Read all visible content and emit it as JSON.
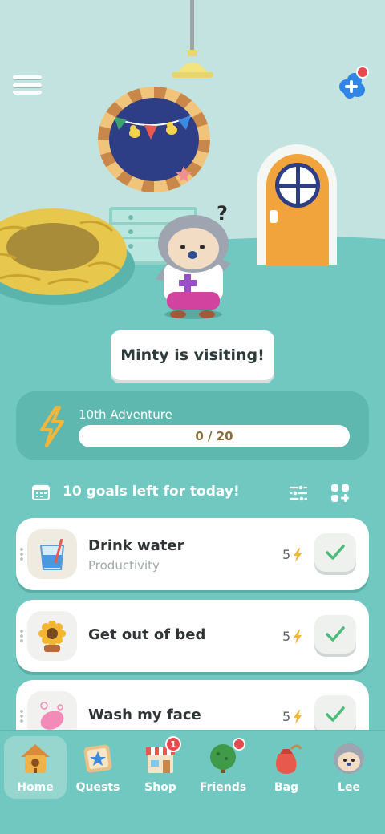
{
  "scene": {
    "status_banner": "Minty is visiting!",
    "character_reaction": "?"
  },
  "top_bar": {
    "menu_icon": "hamburger-menu-icon",
    "add_friend_icon": "add-friend-icon",
    "add_friend_has_notification": true
  },
  "adventure": {
    "title": "10th Adventure",
    "progress_text": "0 / 20",
    "progress_value": 0,
    "progress_max": 20,
    "icon": "lightning-bolt-icon"
  },
  "goals": {
    "header": "10 goals left for today!",
    "items": [
      {
        "name": "Drink water",
        "category": "Productivity",
        "points": "5",
        "icon": "water-glass-icon"
      },
      {
        "name": "Get out of bed",
        "category": "",
        "points": "5",
        "icon": "sunflower-icon"
      },
      {
        "name": "Wash my face",
        "category": "",
        "points": "5",
        "icon": "soap-icon"
      }
    ]
  },
  "tabs": [
    {
      "label": "Home",
      "icon": "birdhouse-icon",
      "active": true
    },
    {
      "label": "Quests",
      "icon": "quest-scroll-icon"
    },
    {
      "label": "Shop",
      "icon": "shop-icon",
      "badge": "1"
    },
    {
      "label": "Friends",
      "icon": "friends-tree-icon",
      "notification": true
    },
    {
      "label": "Bag",
      "icon": "bag-icon"
    },
    {
      "label": "Lee",
      "icon": "profile-avatar-icon"
    }
  ],
  "colors": {
    "background": "#71c8c0",
    "wall": "#c3e3e0",
    "accent_bolt": "#f1b63a",
    "check_green": "#4dbb7a",
    "notification_red": "#e8494d"
  }
}
